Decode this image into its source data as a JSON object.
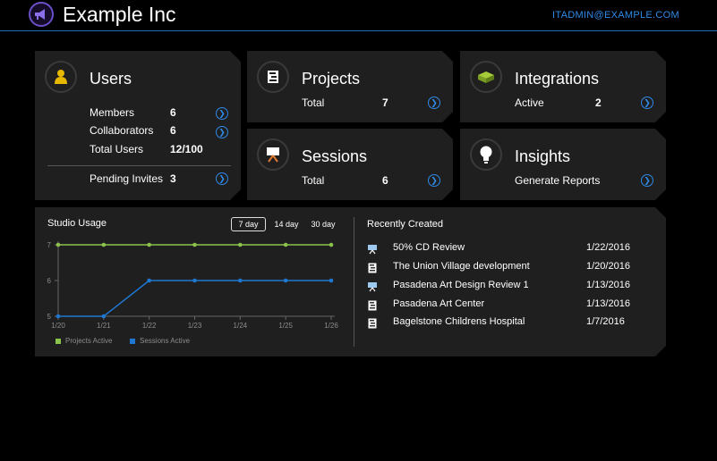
{
  "header": {
    "title": "Example Inc",
    "user": "ITADMIN@EXAMPLE.COM"
  },
  "colors": {
    "accent": "#2f8ae8",
    "projects_line": "#8bc34a",
    "sessions_line": "#1e78d2",
    "users_icon": "#e6b800",
    "integrations_icon": "#8bb42a"
  },
  "cards": {
    "users": {
      "title": "Users",
      "icon": "user-icon",
      "rows": [
        {
          "label": "Members",
          "value": "6"
        },
        {
          "label": "Collaborators",
          "value": "6"
        },
        {
          "label": "Total Users",
          "value": "12/100"
        }
      ],
      "pending": {
        "label": "Pending Invites",
        "value": "3"
      }
    },
    "projects": {
      "title": "Projects",
      "icon": "project-icon",
      "label": "Total",
      "value": "7"
    },
    "integrations": {
      "title": "Integrations",
      "icon": "integration-icon",
      "label": "Active",
      "value": "2"
    },
    "sessions": {
      "title": "Sessions",
      "icon": "session-icon",
      "label": "Total",
      "value": "6"
    },
    "insights": {
      "title": "Insights",
      "icon": "lightbulb-icon",
      "label": "Generate Reports"
    }
  },
  "usage": {
    "title": "Studio Usage",
    "ranges": [
      "7 day",
      "14 day",
      "30 day"
    ],
    "active_range": "7 day"
  },
  "chart_data": {
    "type": "line",
    "x": [
      "1/20",
      "1/21",
      "1/22",
      "1/23",
      "1/24",
      "1/25",
      "1/26"
    ],
    "ylim": [
      5,
      7
    ],
    "yticks": [
      "5",
      "6",
      "7"
    ],
    "series": [
      {
        "name": "Projects Active",
        "values": [
          7,
          7,
          7,
          7,
          7,
          7,
          7
        ],
        "color": "#8bc34a"
      },
      {
        "name": "Sessions Active",
        "values": [
          5,
          5,
          6,
          6,
          6,
          6,
          6
        ],
        "color": "#1e78d2"
      }
    ],
    "legend": "bottom-left"
  },
  "recent": {
    "title": "Recently Created",
    "items": [
      {
        "name": "50% CD Review",
        "date": "1/22/2016",
        "icon": "session-icon"
      },
      {
        "name": "The Union Village development",
        "date": "1/20/2016",
        "icon": "project-icon"
      },
      {
        "name": "Pasadena Art Design Review 1",
        "date": "1/13/2016",
        "icon": "session-icon"
      },
      {
        "name": "Pasadena Art Center",
        "date": "1/13/2016",
        "icon": "project-icon"
      },
      {
        "name": "Bagelstone Childrens Hospital",
        "date": "1/7/2016",
        "icon": "project-icon"
      }
    ]
  }
}
